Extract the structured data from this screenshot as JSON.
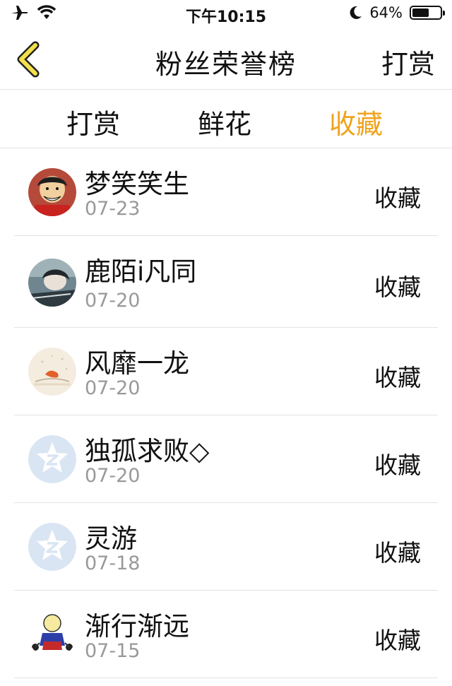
{
  "status_bar": {
    "time": "下午10:15",
    "battery_percent": "64%",
    "battery_level": 0.64,
    "icons": [
      "airplane-icon",
      "wifi-icon",
      "moon-icon",
      "battery-icon"
    ]
  },
  "nav": {
    "title": "粉丝荣誉榜",
    "right_label": "打赏",
    "back_icon": "chevron-left-icon"
  },
  "tabs": [
    {
      "label": "打赏"
    },
    {
      "label": "鲜花"
    },
    {
      "label": "收藏"
    }
  ],
  "active_tab": 2,
  "accent_color": "#f0a31c",
  "rows": [
    {
      "name": "梦笑笑生",
      "date": "07-23",
      "action": "收藏",
      "avatar": "anime-boy-avatar"
    },
    {
      "name": "鹿陌i凡同",
      "date": "07-20",
      "action": "收藏",
      "avatar": "photo-avatar"
    },
    {
      "name": "风靡一龙",
      "date": "07-20",
      "action": "收藏",
      "avatar": "illustration-avatar"
    },
    {
      "name": "独孤求败◇",
      "date": "07-20",
      "action": "收藏",
      "avatar": "default-z-avatar"
    },
    {
      "name": "灵游",
      "date": "07-18",
      "action": "收藏",
      "avatar": "default-z-avatar"
    },
    {
      "name": "渐行渐远",
      "date": "07-15",
      "action": "收藏",
      "avatar": "cartoon-avatar"
    }
  ]
}
